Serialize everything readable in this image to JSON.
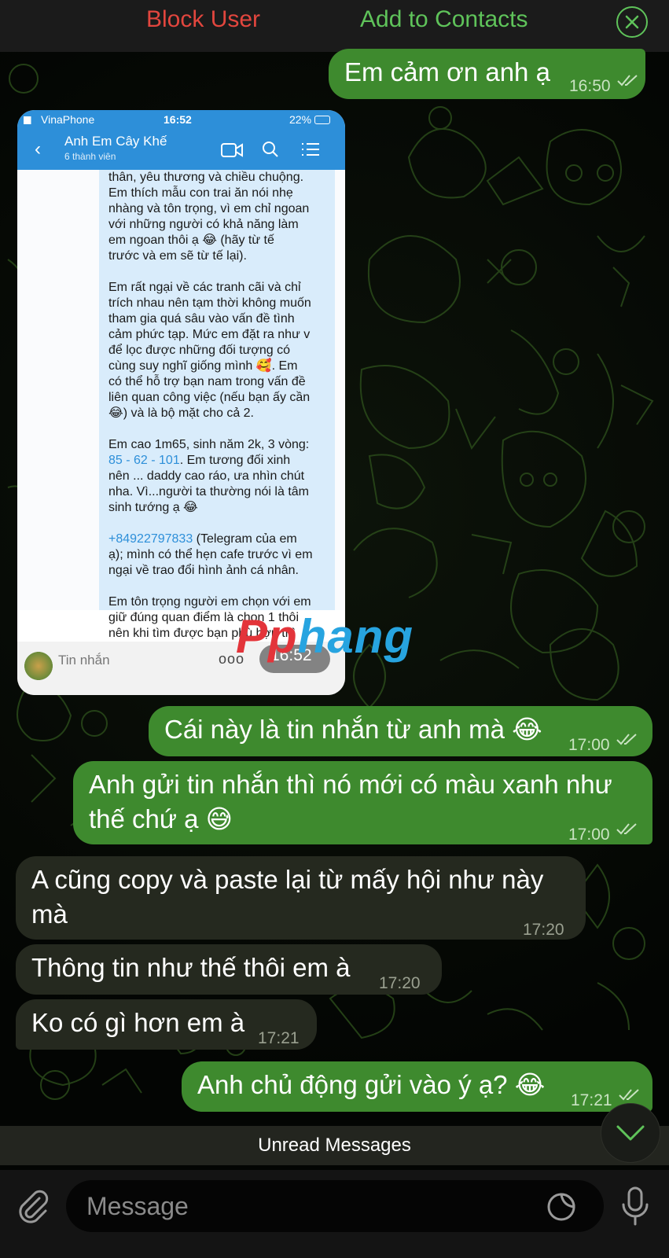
{
  "topbar": {
    "block_user": "Block User",
    "add_contact": "Add to Contacts"
  },
  "messages": [
    {
      "id": "m1",
      "dir": "out",
      "text": "Em cảm ơn anh ạ",
      "time": "16:50"
    },
    {
      "id": "m2",
      "dir": "out",
      "text": "Cái này là tin nhắn từ anh mà 😂",
      "time": "17:00"
    },
    {
      "id": "m3",
      "dir": "out",
      "text": "Anh gửi tin nhắn thì nó mới có màu xanh như thế chứ ạ 😅",
      "time": "17:00"
    },
    {
      "id": "m4",
      "dir": "in",
      "text": "A cũng copy và paste lại từ mấy hội như này mà",
      "time": "17:20"
    },
    {
      "id": "m5",
      "dir": "in",
      "text": "Thông tin như thế thôi em à",
      "time": "17:20"
    },
    {
      "id": "m6",
      "dir": "in",
      "text": "Ko có gì hơn em à",
      "time": "17:21"
    },
    {
      "id": "m7",
      "dir": "out",
      "text": "Anh chủ động gửi vào ý ạ? 😂",
      "time": "17:21"
    }
  ],
  "screenshot": {
    "carrier": "VinaPhone",
    "clock": "16:52",
    "battery": "22%",
    "group_name": "Anh Em Cây Khế",
    "group_members": "6 thành viên",
    "text_1": "thân, yêu thương và chiều chuộng.\nEm thích mẫu con trai ăn nói nhẹ\nnhàng và tôn trọng, vì em chỉ ngoan\nvới những người có khả năng làm\nem ngoan thôi ạ 😂 (hãy từ tế\ntrước và em sẽ từ tế lại).\n\nEm rất ngại về các tranh cãi và chỉ\ntrích nhau nên tạm thời không muốn\ntham gia quá sâu vào vấn đề tình\ncảm phức tạp. Mức em đặt ra như v\nđể lọc được những đối tượng có\ncùng suy nghĩ giống mình 🥰. Em\ncó thể hỗ trợ bạn nam trong vấn đề\nliên quan công việc (nếu bạn ấy cần\n😂) và là bộ mặt cho cả 2.\n\nEm cao 1m65, sinh năm 2k, 3 vòng:",
    "measurements": "85 - 62 - 101",
    "text_2": ". Em tương đối xinh\nnên ... daddy cao ráo, ưa nhìn chút\nnha. Vì...người ta thường nói là tâm\nsinh tướng ạ 😂\n\n",
    "phone": "+84922797833",
    "text_3": " (Telegram của em\nạ); mình có thể hẹn cafe trước vì em\nngại về trao đổi hình ảnh cá nhân.\n\nEm tôn trọng người em chọn với em\ngiữ đúng quan điểm là chọn 1 thôi\nnên khi tìm được bạn phù hợp thì\nem sẽ thông báo trên bài Post này.",
    "footer_label": "Tin nhắn",
    "footer_dots": "ooo",
    "time": "16:52"
  },
  "watermark": {
    "part_red": "Pp",
    "part_blue": "hang"
  },
  "unread_label": "Unread Messages",
  "input": {
    "placeholder": "Message"
  },
  "colors": {
    "outgoing_bubble": "#3e8a2e",
    "incoming_bubble": "#25291f",
    "block_red": "#e2463e",
    "accent_green": "#5fc35a"
  }
}
